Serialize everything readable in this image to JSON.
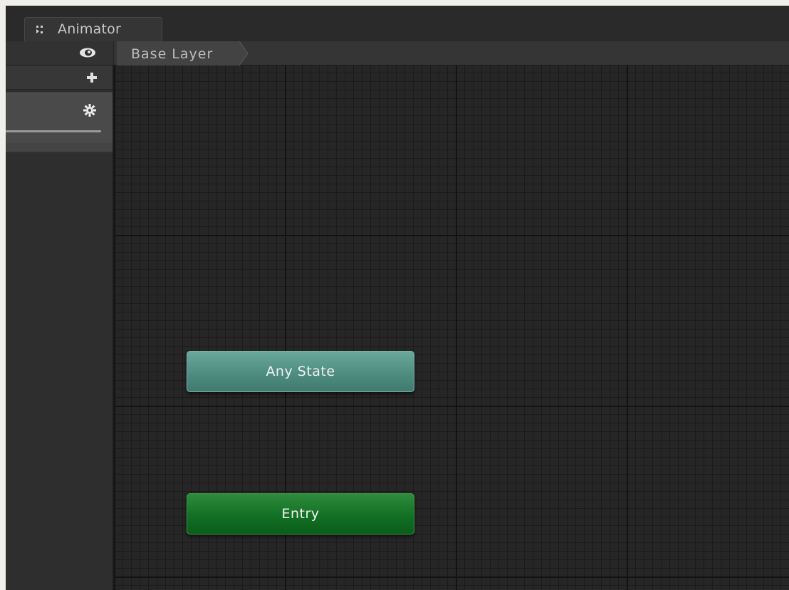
{
  "window": {
    "tab_label": "Animator"
  },
  "breadcrumb": {
    "layer": "Base Layer"
  },
  "layers": {
    "weight_fraction": 1.0
  },
  "graph": {
    "nodes": [
      {
        "label": "Any State",
        "color": "#4e8d80"
      },
      {
        "label": "Entry",
        "color": "#127024"
      }
    ]
  },
  "icons": {
    "tab": "animator-icon",
    "eye": "eye-icon",
    "add": "plus-icon",
    "layer_settings": "gear-icon"
  }
}
